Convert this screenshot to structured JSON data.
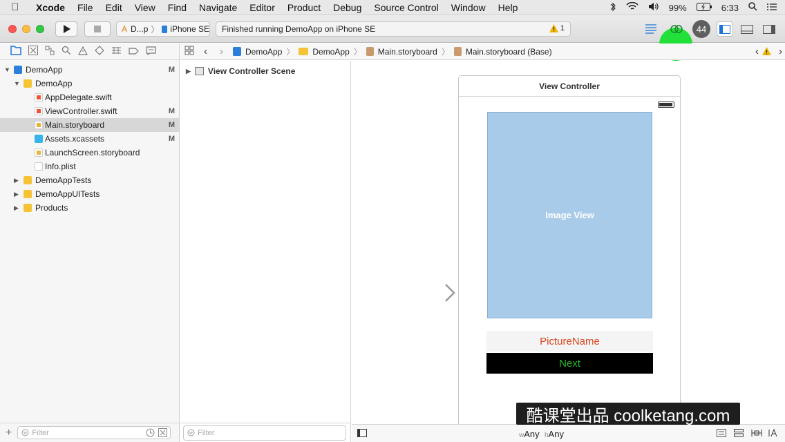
{
  "menubar": {
    "app": "Xcode",
    "items": [
      "File",
      "Edit",
      "View",
      "Find",
      "Navigate",
      "Editor",
      "Product",
      "Debug",
      "Source Control",
      "Window",
      "Help"
    ],
    "battery": "99%",
    "clock": "6:33"
  },
  "toolbar": {
    "scheme_name": "D...p",
    "device": "iPhone SE",
    "status_text": "Finished running DemoApp on iPhone SE",
    "warning_count": "1",
    "issue_count": "44"
  },
  "navigator": {
    "tree": [
      {
        "label": "DemoApp",
        "status": "M",
        "indent": 0,
        "open": true,
        "icon": "project"
      },
      {
        "label": "DemoApp",
        "status": "",
        "indent": 1,
        "open": true,
        "icon": "folder"
      },
      {
        "label": "AppDelegate.swift",
        "status": "",
        "indent": 2,
        "icon": "swift"
      },
      {
        "label": "ViewController.swift",
        "status": "M",
        "indent": 2,
        "icon": "swift"
      },
      {
        "label": "Main.storyboard",
        "status": "M",
        "indent": 2,
        "icon": "storyboard",
        "selected": true
      },
      {
        "label": "Assets.xcassets",
        "status": "M",
        "indent": 2,
        "icon": "assets"
      },
      {
        "label": "LaunchScreen.storyboard",
        "status": "",
        "indent": 2,
        "icon": "storyboard"
      },
      {
        "label": "Info.plist",
        "status": "",
        "indent": 2,
        "icon": "plist"
      },
      {
        "label": "DemoAppTests",
        "status": "",
        "indent": 1,
        "open": false,
        "icon": "folder"
      },
      {
        "label": "DemoAppUITests",
        "status": "",
        "indent": 1,
        "open": false,
        "icon": "folder"
      },
      {
        "label": "Products",
        "status": "",
        "indent": 1,
        "open": false,
        "icon": "folder"
      }
    ],
    "filter_placeholder": "Filter"
  },
  "jumpbar": {
    "crumbs": [
      "DemoApp",
      "DemoApp",
      "Main.storyboard",
      "Main.storyboard (Base)"
    ]
  },
  "outline": {
    "scene_label": "View Controller Scene",
    "filter_placeholder": "Filter"
  },
  "canvas": {
    "scene_title": "View Controller",
    "image_view_label": "Image View",
    "picture_label": "PictureName",
    "next_button": "Next",
    "size_w_prefix": "w",
    "size_w": "Any",
    "size_h_prefix": "h",
    "size_h": "Any"
  },
  "watermark": "酷课堂出品 coolketang.com",
  "colors": {
    "image_view_bg": "#a9cbea",
    "picture_label_text": "#d9451e",
    "next_button_text": "#27b927",
    "next_button_bg": "#000000",
    "highlight_blob": "#22e03a"
  }
}
